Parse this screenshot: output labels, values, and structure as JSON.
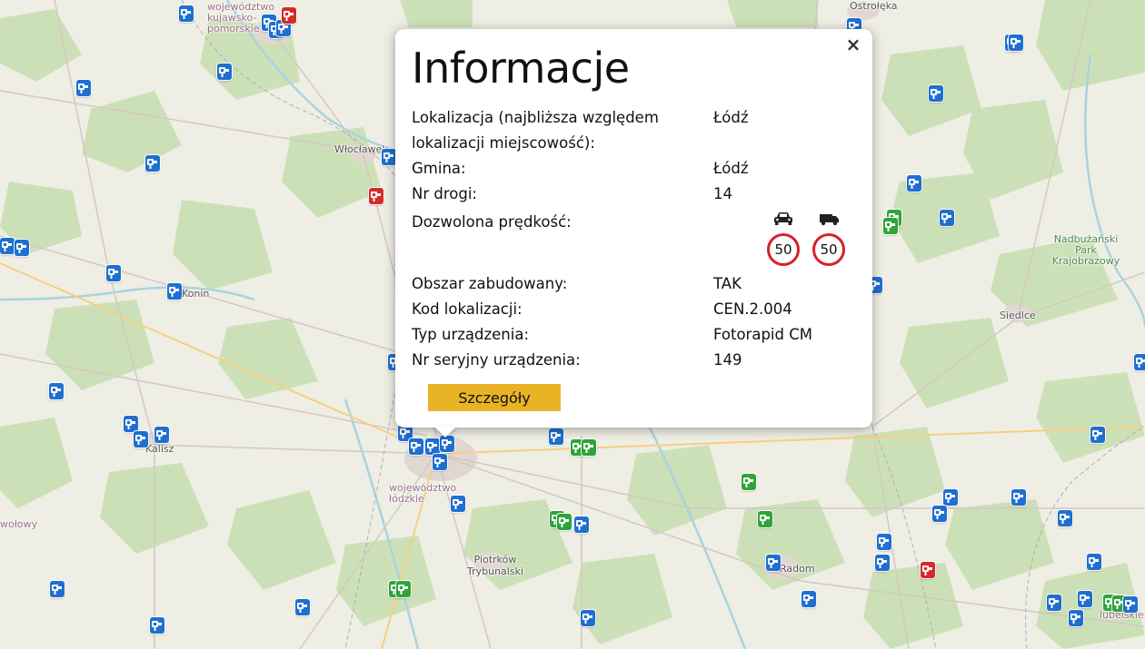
{
  "map": {
    "labels": {
      "region_kujawsko": "województwo kujawsko- pomorskie",
      "ostroleka": "Ostrołęka",
      "wloclawek": "Włocławek",
      "konin": "Konin",
      "kalisz": "Kalisz",
      "region_lodzkie": "województwo łódzkie",
      "piotrkow": "Piotrków Trybunalski",
      "radom": "Radom",
      "siedlce": "Siedlce",
      "park": "Nadbużański Park Krajobrazowy",
      "lubelskie": "lubelskie",
      "wielkopolskie": "wołowy"
    },
    "marker_colors": {
      "blue": "#1f6fd1",
      "green": "#2ea43a",
      "red": "#d42a2a"
    },
    "marker_icon": "speed-camera-icon"
  },
  "popup": {
    "title": "Informacje",
    "close_symbol": "×",
    "rows": [
      {
        "label": "Lokalizacja (najbliższa względem lokalizacji miejscowość):",
        "value": "Łódź"
      },
      {
        "label": "Gmina:",
        "value": "Łódź"
      },
      {
        "label": "Nr drogi:",
        "value": "14"
      },
      {
        "label": "Dozwolona prędkość:",
        "value": ""
      },
      {
        "label": "Obszar zabudowany:",
        "value": "TAK"
      },
      {
        "label": "Kod lokalizacji:",
        "value": "CEN.2.004"
      },
      {
        "label": "Typ urządzenia:",
        "value": "Fotorapid CM"
      },
      {
        "label": "Nr seryjny urządzenia:",
        "value": "149"
      }
    ],
    "speed_limits": {
      "car_icon": "car-icon",
      "truck_icon": "truck-icon",
      "car": "50",
      "truck": "50",
      "sign_border_color": "#d8202a"
    },
    "details_button": "Szczegóły",
    "details_button_color": "#e8b325"
  }
}
